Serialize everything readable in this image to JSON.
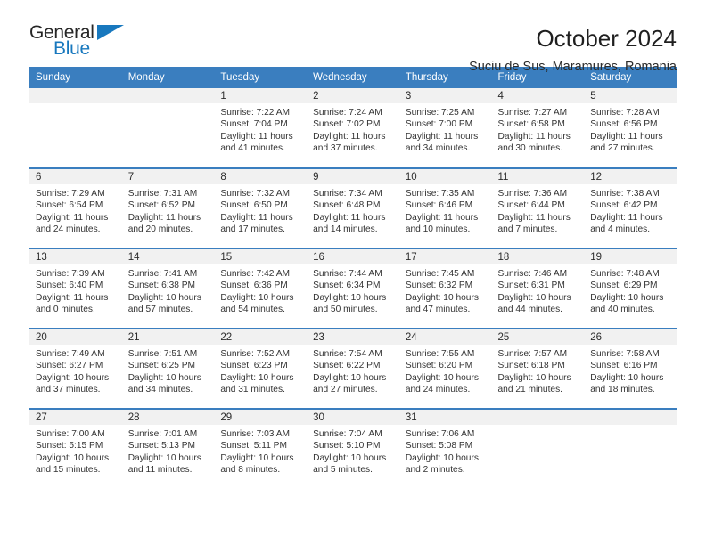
{
  "brand": {
    "name_part1": "General",
    "name_part2": "Blue",
    "logo_icon": "triangle-flag-icon"
  },
  "header": {
    "title": "October 2024",
    "subtitle": "Suciu de Sus, Maramures, Romania"
  },
  "colors": {
    "header_blue": "#3a7ebf",
    "brand_blue": "#1878be",
    "band_gray": "#f1f1f1",
    "text": "#333333"
  },
  "weekdays": [
    "Sunday",
    "Monday",
    "Tuesday",
    "Wednesday",
    "Thursday",
    "Friday",
    "Saturday"
  ],
  "labels": {
    "sunrise_prefix": "Sunrise:",
    "sunset_prefix": "Sunset:",
    "daylight_prefix": "Daylight:"
  },
  "weeks": [
    [
      {
        "day": "",
        "empty": true
      },
      {
        "day": "",
        "empty": true
      },
      {
        "day": "1",
        "sunrise": "Sunrise: 7:22 AM",
        "sunset": "Sunset: 7:04 PM",
        "daylight_l1": "Daylight: 11 hours",
        "daylight_l2": "and 41 minutes."
      },
      {
        "day": "2",
        "sunrise": "Sunrise: 7:24 AM",
        "sunset": "Sunset: 7:02 PM",
        "daylight_l1": "Daylight: 11 hours",
        "daylight_l2": "and 37 minutes."
      },
      {
        "day": "3",
        "sunrise": "Sunrise: 7:25 AM",
        "sunset": "Sunset: 7:00 PM",
        "daylight_l1": "Daylight: 11 hours",
        "daylight_l2": "and 34 minutes."
      },
      {
        "day": "4",
        "sunrise": "Sunrise: 7:27 AM",
        "sunset": "Sunset: 6:58 PM",
        "daylight_l1": "Daylight: 11 hours",
        "daylight_l2": "and 30 minutes."
      },
      {
        "day": "5",
        "sunrise": "Sunrise: 7:28 AM",
        "sunset": "Sunset: 6:56 PM",
        "daylight_l1": "Daylight: 11 hours",
        "daylight_l2": "and 27 minutes."
      }
    ],
    [
      {
        "day": "6",
        "sunrise": "Sunrise: 7:29 AM",
        "sunset": "Sunset: 6:54 PM",
        "daylight_l1": "Daylight: 11 hours",
        "daylight_l2": "and 24 minutes."
      },
      {
        "day": "7",
        "sunrise": "Sunrise: 7:31 AM",
        "sunset": "Sunset: 6:52 PM",
        "daylight_l1": "Daylight: 11 hours",
        "daylight_l2": "and 20 minutes."
      },
      {
        "day": "8",
        "sunrise": "Sunrise: 7:32 AM",
        "sunset": "Sunset: 6:50 PM",
        "daylight_l1": "Daylight: 11 hours",
        "daylight_l2": "and 17 minutes."
      },
      {
        "day": "9",
        "sunrise": "Sunrise: 7:34 AM",
        "sunset": "Sunset: 6:48 PM",
        "daylight_l1": "Daylight: 11 hours",
        "daylight_l2": "and 14 minutes."
      },
      {
        "day": "10",
        "sunrise": "Sunrise: 7:35 AM",
        "sunset": "Sunset: 6:46 PM",
        "daylight_l1": "Daylight: 11 hours",
        "daylight_l2": "and 10 minutes."
      },
      {
        "day": "11",
        "sunrise": "Sunrise: 7:36 AM",
        "sunset": "Sunset: 6:44 PM",
        "daylight_l1": "Daylight: 11 hours",
        "daylight_l2": "and 7 minutes."
      },
      {
        "day": "12",
        "sunrise": "Sunrise: 7:38 AM",
        "sunset": "Sunset: 6:42 PM",
        "daylight_l1": "Daylight: 11 hours",
        "daylight_l2": "and 4 minutes."
      }
    ],
    [
      {
        "day": "13",
        "sunrise": "Sunrise: 7:39 AM",
        "sunset": "Sunset: 6:40 PM",
        "daylight_l1": "Daylight: 11 hours",
        "daylight_l2": "and 0 minutes."
      },
      {
        "day": "14",
        "sunrise": "Sunrise: 7:41 AM",
        "sunset": "Sunset: 6:38 PM",
        "daylight_l1": "Daylight: 10 hours",
        "daylight_l2": "and 57 minutes."
      },
      {
        "day": "15",
        "sunrise": "Sunrise: 7:42 AM",
        "sunset": "Sunset: 6:36 PM",
        "daylight_l1": "Daylight: 10 hours",
        "daylight_l2": "and 54 minutes."
      },
      {
        "day": "16",
        "sunrise": "Sunrise: 7:44 AM",
        "sunset": "Sunset: 6:34 PM",
        "daylight_l1": "Daylight: 10 hours",
        "daylight_l2": "and 50 minutes."
      },
      {
        "day": "17",
        "sunrise": "Sunrise: 7:45 AM",
        "sunset": "Sunset: 6:32 PM",
        "daylight_l1": "Daylight: 10 hours",
        "daylight_l2": "and 47 minutes."
      },
      {
        "day": "18",
        "sunrise": "Sunrise: 7:46 AM",
        "sunset": "Sunset: 6:31 PM",
        "daylight_l1": "Daylight: 10 hours",
        "daylight_l2": "and 44 minutes."
      },
      {
        "day": "19",
        "sunrise": "Sunrise: 7:48 AM",
        "sunset": "Sunset: 6:29 PM",
        "daylight_l1": "Daylight: 10 hours",
        "daylight_l2": "and 40 minutes."
      }
    ],
    [
      {
        "day": "20",
        "sunrise": "Sunrise: 7:49 AM",
        "sunset": "Sunset: 6:27 PM",
        "daylight_l1": "Daylight: 10 hours",
        "daylight_l2": "and 37 minutes."
      },
      {
        "day": "21",
        "sunrise": "Sunrise: 7:51 AM",
        "sunset": "Sunset: 6:25 PM",
        "daylight_l1": "Daylight: 10 hours",
        "daylight_l2": "and 34 minutes."
      },
      {
        "day": "22",
        "sunrise": "Sunrise: 7:52 AM",
        "sunset": "Sunset: 6:23 PM",
        "daylight_l1": "Daylight: 10 hours",
        "daylight_l2": "and 31 minutes."
      },
      {
        "day": "23",
        "sunrise": "Sunrise: 7:54 AM",
        "sunset": "Sunset: 6:22 PM",
        "daylight_l1": "Daylight: 10 hours",
        "daylight_l2": "and 27 minutes."
      },
      {
        "day": "24",
        "sunrise": "Sunrise: 7:55 AM",
        "sunset": "Sunset: 6:20 PM",
        "daylight_l1": "Daylight: 10 hours",
        "daylight_l2": "and 24 minutes."
      },
      {
        "day": "25",
        "sunrise": "Sunrise: 7:57 AM",
        "sunset": "Sunset: 6:18 PM",
        "daylight_l1": "Daylight: 10 hours",
        "daylight_l2": "and 21 minutes."
      },
      {
        "day": "26",
        "sunrise": "Sunrise: 7:58 AM",
        "sunset": "Sunset: 6:16 PM",
        "daylight_l1": "Daylight: 10 hours",
        "daylight_l2": "and 18 minutes."
      }
    ],
    [
      {
        "day": "27",
        "sunrise": "Sunrise: 7:00 AM",
        "sunset": "Sunset: 5:15 PM",
        "daylight_l1": "Daylight: 10 hours",
        "daylight_l2": "and 15 minutes."
      },
      {
        "day": "28",
        "sunrise": "Sunrise: 7:01 AM",
        "sunset": "Sunset: 5:13 PM",
        "daylight_l1": "Daylight: 10 hours",
        "daylight_l2": "and 11 minutes."
      },
      {
        "day": "29",
        "sunrise": "Sunrise: 7:03 AM",
        "sunset": "Sunset: 5:11 PM",
        "daylight_l1": "Daylight: 10 hours",
        "daylight_l2": "and 8 minutes."
      },
      {
        "day": "30",
        "sunrise": "Sunrise: 7:04 AM",
        "sunset": "Sunset: 5:10 PM",
        "daylight_l1": "Daylight: 10 hours",
        "daylight_l2": "and 5 minutes."
      },
      {
        "day": "31",
        "sunrise": "Sunrise: 7:06 AM",
        "sunset": "Sunset: 5:08 PM",
        "daylight_l1": "Daylight: 10 hours",
        "daylight_l2": "and 2 minutes."
      },
      {
        "day": "",
        "empty": true
      },
      {
        "day": "",
        "empty": true
      }
    ]
  ]
}
